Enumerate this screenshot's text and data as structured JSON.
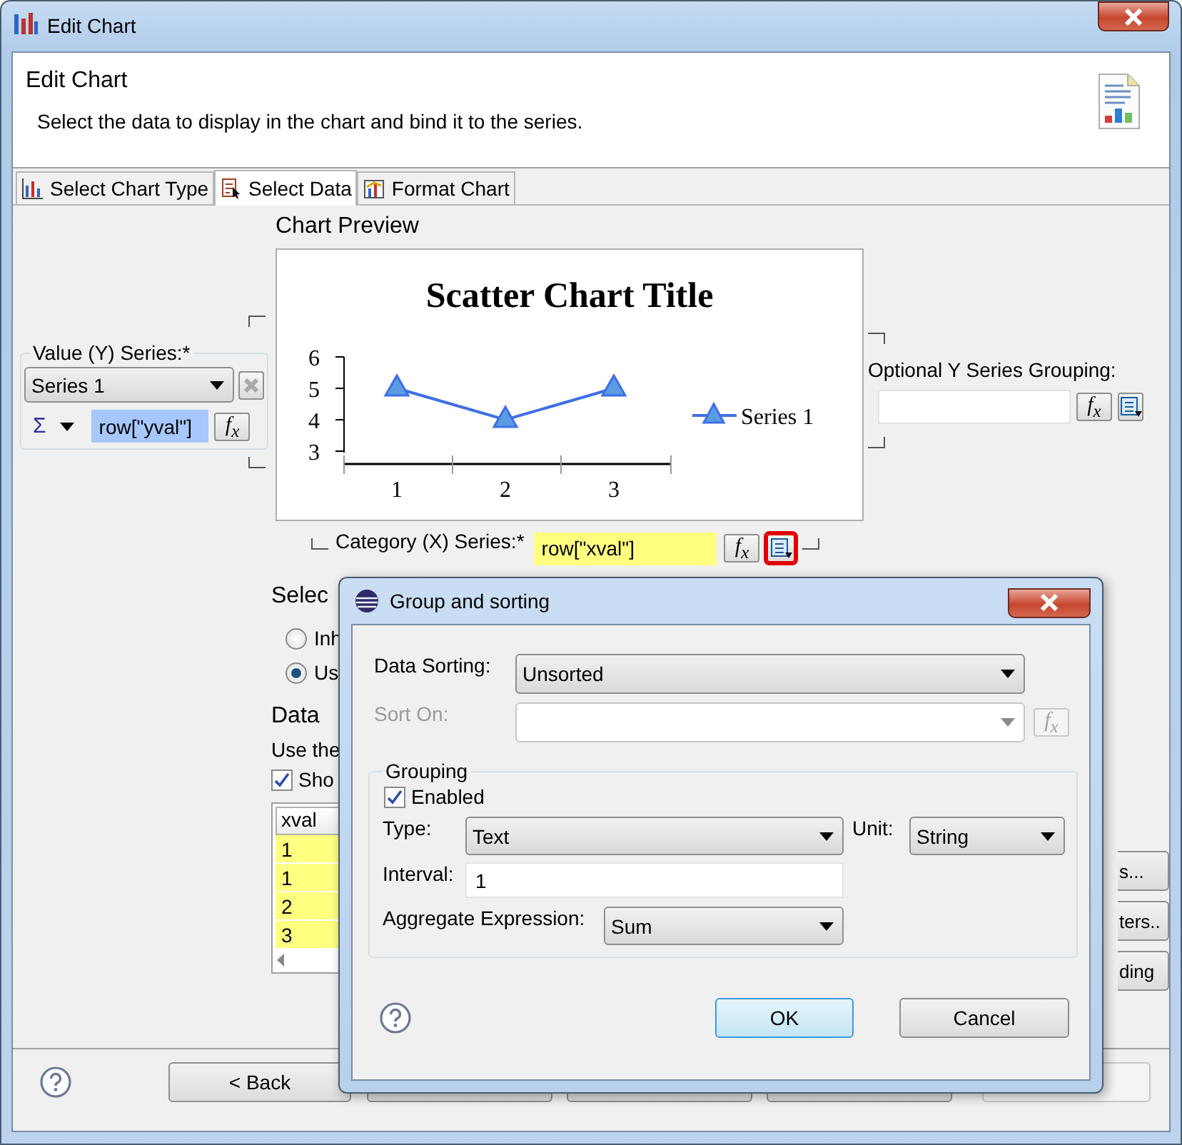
{
  "window": {
    "title": "Edit Chart"
  },
  "header": {
    "title": "Edit Chart",
    "description": "Select the data to display in the chart and bind it to the series."
  },
  "tabs": [
    {
      "label": "Select Chart Type",
      "selected": false
    },
    {
      "label": "Select Data",
      "selected": true
    },
    {
      "label": "Format Chart",
      "selected": false
    }
  ],
  "value_series": {
    "label": "Value (Y) Series:*",
    "series_select": "Series 1",
    "aggregate": "Σ",
    "expression": "row[\"yval\"]",
    "function_button": "f$_{x}$"
  },
  "chart_preview": {
    "label": "Chart Preview",
    "chart_data": {
      "type": "line",
      "title": "Scatter Chart Title",
      "categories": [
        "1",
        "2",
        "3"
      ],
      "series": [
        {
          "name": "Series 1",
          "color": "#3f6fe6",
          "marker": "triangle",
          "values": [
            5,
            4,
            5
          ]
        }
      ],
      "ylim": [
        3,
        6
      ],
      "yticks": [
        3,
        4,
        5,
        6
      ]
    }
  },
  "optional_grouping": {
    "label": "Optional Y Series Grouping:",
    "function_button": "f$_{x}$"
  },
  "category_series": {
    "label": "Category (X) Series:*",
    "expression": "row[\"xval\"]",
    "function_button": "f$_{x}$",
    "grouping_highlighted": true
  },
  "data_section": {
    "heading": "Selec",
    "options": [
      {
        "label": "Inh",
        "selected": false
      },
      {
        "label": "Us",
        "selected": true
      }
    ],
    "preview_heading": "Data",
    "hint": "Use the",
    "show_checkbox": {
      "label": "Sho",
      "checked": true
    },
    "table": {
      "columns": [
        "xval"
      ],
      "rows": [
        "1",
        "1",
        "2",
        "3"
      ]
    },
    "side_buttons": [
      "s...",
      "ters..",
      "ding"
    ]
  },
  "footer": {
    "buttons": [
      {
        "kind": "labeled",
        "label": "< Back",
        "disabled": false
      },
      {
        "kind": "covered",
        "disabled": false
      },
      {
        "kind": "covered",
        "disabled": false
      },
      {
        "kind": "covered",
        "disabled": false
      },
      {
        "kind": "covered",
        "disabled": true
      }
    ]
  },
  "dialog": {
    "title": "Group and sorting",
    "sorting": {
      "label": "Data Sorting:",
      "value": "Unsorted"
    },
    "sort_on": {
      "label": "Sort On:",
      "disabled": true,
      "function_button": "f$_{x}$"
    },
    "grouping": {
      "legend": "Grouping",
      "enabled": {
        "label": "Enabled",
        "checked": true
      },
      "type": {
        "label": "Type:",
        "value": "Text"
      },
      "unit": {
        "label": "Unit:",
        "value": "String"
      },
      "interval": {
        "label": "Interval:",
        "value": "1"
      },
      "aggregate": {
        "label": "Aggregate Expression:",
        "value": "Sum"
      }
    },
    "buttons": [
      {
        "label": "OK",
        "default": true
      },
      {
        "label": "Cancel",
        "default": false
      }
    ]
  }
}
